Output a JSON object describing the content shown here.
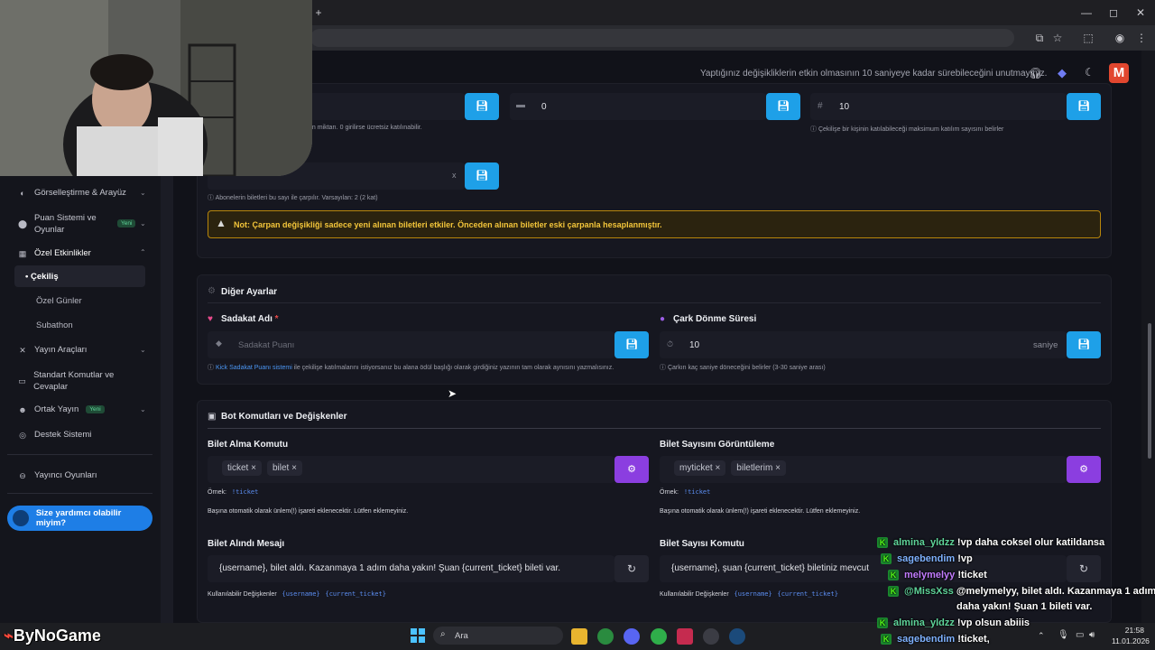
{
  "browser": {
    "new_tab": "+",
    "window_controls": [
      "—",
      "◻",
      "✕"
    ]
  },
  "topbar": {
    "note": "Yaptığınız değişikliklerin etkin olmasının 10 saniyeye kadar sürebileceğini unutmayınız.",
    "avatar_letter": "M"
  },
  "sidebar": {
    "items": [
      {
        "label": "Görselleştirme & Arayüz",
        "icon": "palette-icon"
      },
      {
        "label": "Puan Sistemi ve Oyunlar",
        "icon": "coins-icon",
        "badge": "Yeni"
      },
      {
        "label": "Özel Etkinlikler",
        "icon": "calendar-icon"
      },
      {
        "label": "Yayın Araçları",
        "icon": "tools-icon"
      },
      {
        "label": "Standart Komutlar ve Cevaplar",
        "icon": "keyboard-icon"
      },
      {
        "label": "Ortak Yayın",
        "icon": "users-icon",
        "badge": "Yeni"
      },
      {
        "label": "Destek Sistemi",
        "icon": "support-icon"
      },
      {
        "label": "Yayıncı Oyunları",
        "icon": "gamepad-icon"
      }
    ],
    "sub_items": [
      "Çekiliş",
      "Özel Günler",
      "Subathon"
    ],
    "help": "Size yardımcı olabilir miyim?"
  },
  "ticket_settings": {
    "field1_hint_partial": "an miktarı. 0 girilirse ücretsiz katılınabilir.",
    "field2_value": "0",
    "field3_value": "10",
    "field3_hint": "Çekilişe bir kişinin katılabileceği maksimum katılım sayısını belirler",
    "multiplier_suffix": "x",
    "multiplier_hint": "Abonelerin biletleri bu sayı ile çarpılır. Varsayılan: 2 (2 kat)",
    "warning": "Not: Çarpan değişikliği sadece yeni alınan biletleri etkiler. Önceden alınan biletler eski çarpanla hesaplanmıştır."
  },
  "other_settings": {
    "title": "Diğer Ayarlar",
    "loyalty_label": "Sadakat Adı",
    "required_mark": "*",
    "loyalty_placeholder": "Sadakat Puanı",
    "loyalty_hint_link": "Kick Sadakat Puanı sistemi",
    "loyalty_hint": "ile çekilişe katılmalarını istiyorsanız bu alana ödül başlığı olarak girdiğiniz yazının tam olarak aynısını yazmalısınız.",
    "spin_label": "Çark Dönme Süresi",
    "spin_value": "10",
    "spin_unit": "saniye",
    "spin_hint": "Çarkın kaç saniye döneceğini belirler (3-30 saniye arası)"
  },
  "bot_commands": {
    "title": "Bot Komutları ve Değişkenler",
    "buy_label": "Bilet Alma Komutu",
    "buy_chips": [
      "ticket",
      "bilet"
    ],
    "view_label": "Bilet Sayısını Görüntüleme",
    "view_chips": [
      "myticket",
      "biletlerim"
    ],
    "example_label": "Örnek:",
    "buy_example": "!ticket",
    "view_example": "!ticket",
    "prefix_note": "Başına otomatik olarak ünlem(!) işareti eklenecektir. Lütfen eklemeyiniz.",
    "received_label": "Bilet Alındı Mesajı",
    "received_value": "{username}, bilet aldı. Kazanmaya 1 adım daha yakın! Şuan {current_ticket} bileti var.",
    "count_label": "Bilet Sayısı Komutu",
    "count_value": "{username}, şuan {current_ticket} biletiniz mevcut",
    "vars_label": "Kullanılabilir Değişkenler",
    "vars": [
      "{username}",
      "{current_ticket}"
    ]
  },
  "taskbar": {
    "search": "Ara",
    "time": "21:58",
    "date": "11.01.2026"
  },
  "watermark": "ByNoGame",
  "chat": [
    {
      "user": "almina_yldzz",
      "color": "#5fd49a",
      "msg": "!vp daha coksel olur katildansa"
    },
    {
      "user": "sagebendim",
      "color": "#7fb2ff",
      "msg": "!vp"
    },
    {
      "user": "melymelyy",
      "color": "#c27cff",
      "msg": "!ticket"
    },
    {
      "user": "@MissXss",
      "color": "#5fd49a",
      "msg": "@melymelyy, bilet aldı. Kazanmaya 1 adım"
    },
    {
      "user": "",
      "color": "#ffffff",
      "msg": "daha yakın! Şuan 1 bileti var."
    },
    {
      "user": "almina_yldzz",
      "color": "#5fd49a",
      "msg": "!vp olsun abiiis"
    },
    {
      "user": "sagebendim",
      "color": "#7fb2ff",
      "msg": "!ticket,"
    }
  ]
}
